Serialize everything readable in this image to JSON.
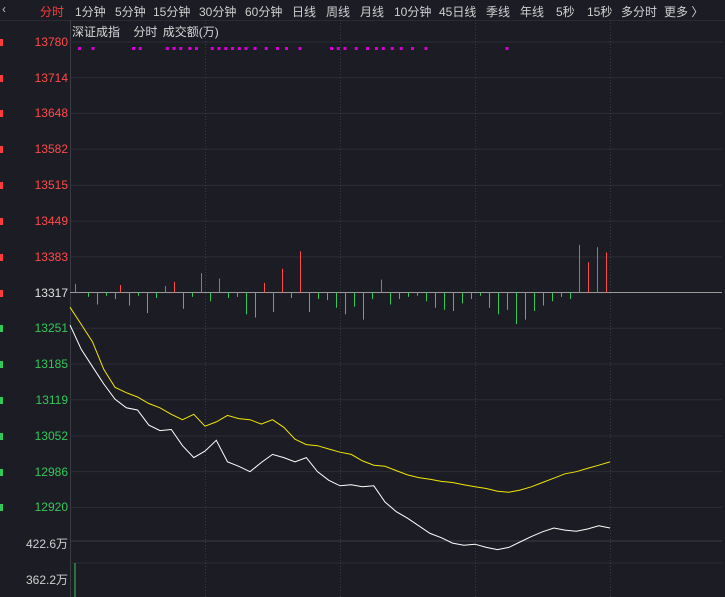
{
  "toolbar": {
    "back_glyph": "‹",
    "tabs": [
      {
        "label": "分时",
        "active": true
      },
      {
        "label": "1分钟",
        "active": false
      },
      {
        "label": "5分钟",
        "active": false
      },
      {
        "label": "15分钟",
        "active": false
      },
      {
        "label": "30分钟",
        "active": false
      },
      {
        "label": "60分钟",
        "active": false
      },
      {
        "label": "日线",
        "active": false
      },
      {
        "label": "周线",
        "active": false
      },
      {
        "label": "月线",
        "active": false
      },
      {
        "label": "10分钟",
        "active": false
      },
      {
        "label": "45日线",
        "active": false
      },
      {
        "label": "季线",
        "active": false
      },
      {
        "label": "年线",
        "active": false
      },
      {
        "label": "5秒",
        "active": false
      },
      {
        "label": "15秒",
        "active": false
      },
      {
        "label": "多分时",
        "active": false
      },
      {
        "label": "更多 〉",
        "active": false
      }
    ]
  },
  "subhead": {
    "index_name": "深证成指",
    "mode": "分时",
    "indicator": "成交额(万)"
  },
  "colors": {
    "background": "#1c1d24",
    "up": "#ff4a4a",
    "down": "#34c759",
    "price_line": "#ffffff",
    "avg_line": "#f2e600",
    "signal_dots": "#d400d4",
    "grid": "#2e2f38"
  },
  "chart_data": {
    "type": "line",
    "x_range": [
      0,
      240
    ],
    "y_ticks_price": [
      13780,
      13714,
      13648,
      13582,
      13515,
      13449,
      13383,
      13317,
      13251,
      13185,
      13119,
      13052,
      12986,
      12920
    ],
    "y_ticks_volume": [
      "422.6万",
      "362.2万"
    ],
    "base_price": 13317,
    "series": [
      {
        "role": "price",
        "x": [
          0,
          5,
          10,
          15,
          20,
          25,
          30,
          35,
          40,
          45,
          50,
          55,
          60,
          65,
          70,
          75,
          80,
          85,
          90,
          95,
          100,
          105,
          110,
          115,
          120,
          125,
          130,
          135,
          140,
          145,
          150,
          155,
          160,
          165,
          170,
          175,
          180,
          185,
          190,
          195,
          200,
          205,
          210,
          215,
          220,
          225,
          230,
          235,
          240
        ],
        "values": [
          13257,
          13212,
          13180,
          13148,
          13120,
          13104,
          13100,
          13072,
          13062,
          13064,
          13034,
          13012,
          13024,
          13044,
          13004,
          12996,
          12986,
          13003,
          13018,
          13012,
          13004,
          13012,
          12986,
          12970,
          12960,
          12962,
          12958,
          12960,
          12930,
          12912,
          12900,
          12886,
          12872,
          12864,
          12854,
          12850,
          12852,
          12846,
          12842,
          12846,
          12856,
          12866,
          12875,
          12882,
          12878,
          12876,
          12880,
          12886,
          12882
        ]
      },
      {
        "role": "average",
        "x": [
          0,
          5,
          10,
          15,
          20,
          25,
          30,
          35,
          40,
          45,
          50,
          55,
          60,
          65,
          70,
          75,
          80,
          85,
          90,
          95,
          100,
          105,
          110,
          115,
          120,
          125,
          130,
          135,
          140,
          145,
          150,
          155,
          160,
          165,
          170,
          175,
          180,
          185,
          190,
          195,
          200,
          205,
          210,
          215,
          220,
          225,
          230,
          235,
          240
        ],
        "values": [
          13290,
          13258,
          13226,
          13175,
          13142,
          13132,
          13124,
          13112,
          13104,
          13092,
          13082,
          13092,
          13070,
          13078,
          13090,
          13084,
          13082,
          13074,
          13082,
          13068,
          13046,
          13036,
          13034,
          13028,
          13022,
          13018,
          13006,
          12998,
          12996,
          12988,
          12980,
          12975,
          12972,
          12968,
          12966,
          12962,
          12958,
          12955,
          12950,
          12948,
          12952,
          12958,
          12966,
          12974,
          12982,
          12986,
          12992,
          12998,
          13004
        ]
      }
    ],
    "difference_bars": {
      "x": [
        2,
        8,
        12,
        16,
        20,
        22,
        26,
        30,
        34,
        38,
        42,
        46,
        50,
        54,
        58,
        62,
        66,
        70,
        74,
        78,
        82,
        86,
        90,
        94,
        98,
        102,
        106,
        110,
        114,
        118,
        122,
        126,
        130,
        134,
        138,
        142,
        146,
        150,
        154,
        158,
        162,
        166,
        170,
        174,
        178,
        182,
        186,
        190,
        194,
        198,
        202,
        206,
        210,
        214,
        218,
        222,
        226,
        230,
        234,
        238
      ],
      "values": [
        16,
        -8,
        -22,
        -6,
        -12,
        14,
        -24,
        -6,
        -38,
        -10,
        12,
        20,
        -30,
        -8,
        36,
        -16,
        26,
        -10,
        -8,
        -40,
        -46,
        18,
        -36,
        44,
        -10,
        76,
        -36,
        -12,
        -14,
        -28,
        -40,
        -26,
        -50,
        -12,
        24,
        -22,
        -12,
        -8,
        -6,
        -16,
        -28,
        -32,
        -34,
        -20,
        -12,
        -6,
        -28,
        -40,
        -32,
        -58,
        -50,
        -34,
        -24,
        -16,
        -8,
        -12,
        88,
        56,
        84,
        74
      ]
    },
    "signal_dots_x": [
      4,
      10,
      28,
      31,
      43,
      46,
      49,
      53,
      56,
      63,
      66,
      69,
      72,
      75,
      78,
      82,
      87,
      92,
      96,
      102,
      116,
      119,
      122,
      127,
      132,
      136,
      139,
      143,
      147,
      152,
      158,
      194
    ],
    "volume_bar": {
      "x": 2,
      "value": 362.2
    }
  }
}
